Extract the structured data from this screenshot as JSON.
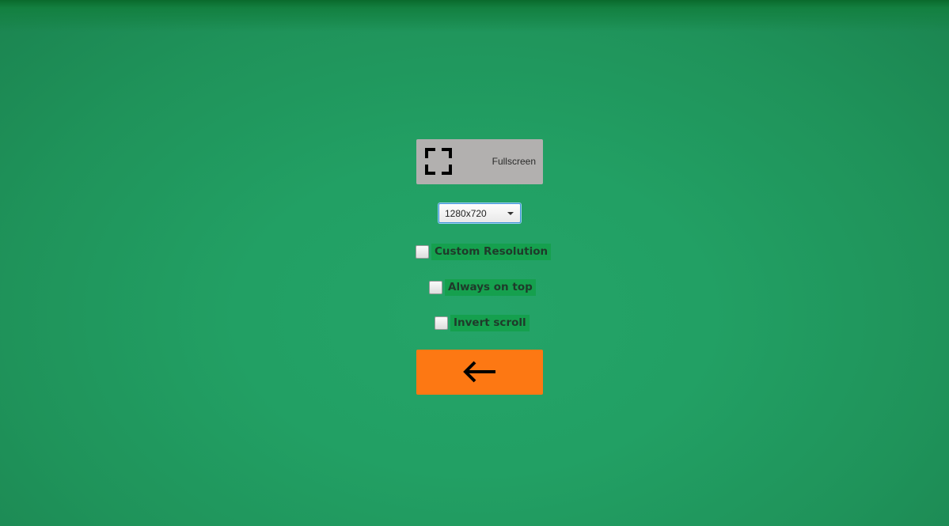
{
  "fullscreen_button": {
    "label": "Fullscreen",
    "icon": "fullscreen-icon"
  },
  "resolution_select": {
    "value": "1280x720"
  },
  "options": {
    "custom_resolution": {
      "label": "Custom Resolution",
      "checked": false
    },
    "always_on_top": {
      "label": "Always on top",
      "checked": false
    },
    "invert_scroll": {
      "label": "Invert scroll",
      "checked": false
    }
  },
  "back_button": {
    "icon": "arrow-left-icon"
  },
  "colors": {
    "background": "#22a064",
    "fullscreen_button": "#b2b0af",
    "back_button": "#fd7813",
    "label_background": "#15a04e"
  }
}
